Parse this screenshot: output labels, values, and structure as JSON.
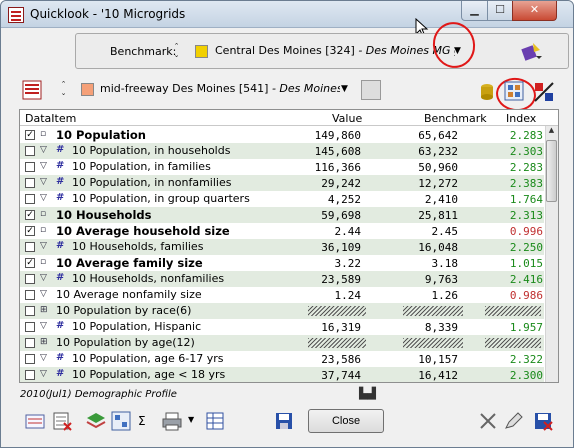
{
  "window": {
    "title": "Quicklook - '10 Microgrids"
  },
  "benchmark": {
    "label": "Benchmark:",
    "name": "Central Des Moines [324]",
    "group": " - Des Moines MG group"
  },
  "area": {
    "name": "mid-freeway Des Moines [541]",
    "group": " - Des Moines MG g"
  },
  "grid": {
    "headers": {
      "item": "DataItem",
      "value": "Value",
      "benchmark": "Benchmark",
      "index": "Index"
    },
    "rows": [
      {
        "label": "10 Population",
        "value": "149,860",
        "benchmark": "65,642",
        "index": "2.283"
      },
      {
        "label": "10 Population, in households",
        "value": "145,608",
        "benchmark": "63,232",
        "index": "2.303"
      },
      {
        "label": "10 Population, in families",
        "value": "116,366",
        "benchmark": "50,960",
        "index": "2.283"
      },
      {
        "label": "10 Population, in nonfamilies",
        "value": "29,242",
        "benchmark": "12,272",
        "index": "2.383"
      },
      {
        "label": "10 Population, in group quarters",
        "value": "4,252",
        "benchmark": "2,410",
        "index": "1.764"
      },
      {
        "label": "10 Households",
        "value": "59,698",
        "benchmark": "25,811",
        "index": "2.313"
      },
      {
        "label": "10 Average household size",
        "value": "2.44",
        "benchmark": "2.45",
        "index": "0.996"
      },
      {
        "label": "10 Households, families",
        "value": "36,109",
        "benchmark": "16,048",
        "index": "2.250"
      },
      {
        "label": "10 Average family size",
        "value": "3.22",
        "benchmark": "3.18",
        "index": "1.015"
      },
      {
        "label": "10 Households, nonfamilies",
        "value": "23,589",
        "benchmark": "9,763",
        "index": "2.416"
      },
      {
        "label": "10 Average nonfamily size",
        "value": "1.24",
        "benchmark": "1.26",
        "index": "0.986"
      },
      {
        "label": "10 Population by race(6)",
        "value": "",
        "benchmark": "",
        "index": ""
      },
      {
        "label": "10 Population, Hispanic",
        "value": "16,319",
        "benchmark": "8,339",
        "index": "1.957"
      },
      {
        "label": "10 Population by age(12)",
        "value": "",
        "benchmark": "",
        "index": ""
      },
      {
        "label": "10 Population, age 6-17 yrs",
        "value": "23,586",
        "benchmark": "10,157",
        "index": "2.322"
      },
      {
        "label": "10 Population, age < 18 yrs",
        "value": "37,744",
        "benchmark": "16,412",
        "index": "2.300"
      }
    ]
  },
  "footer": {
    "caption": "2010(Jul1) Demographic Profile",
    "sigma": "Σ",
    "close_label": "Close"
  },
  "colors": {
    "index_green": "#1a8a1a",
    "index_red": "#c03030",
    "row_alt": "#e2ebe0",
    "bench_swatch": "#f2d000",
    "area_swatch": "#f5a078",
    "highlight": "#e01818"
  }
}
